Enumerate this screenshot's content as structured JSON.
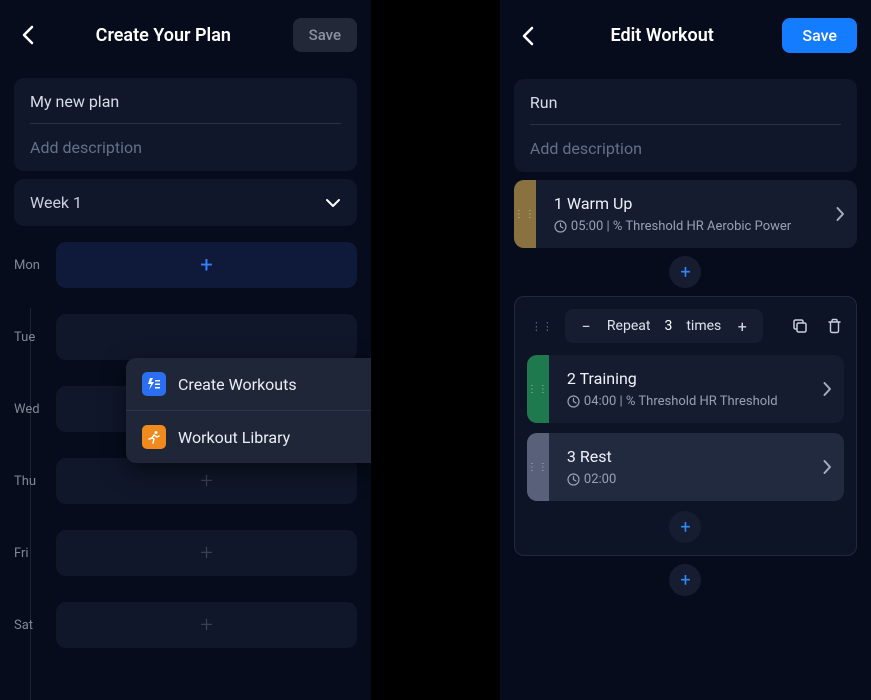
{
  "left": {
    "title": "Create Your Plan",
    "save": "Save",
    "planName": "My new plan",
    "descPlaceholder": "Add description",
    "weekLabel": "Week 1",
    "days": [
      "Mon",
      "Tue",
      "Wed",
      "Thu",
      "Fri",
      "Sat"
    ],
    "popup": {
      "create": "Create Workouts",
      "library": "Workout Library"
    }
  },
  "right": {
    "title": "Edit Workout",
    "save": "Save",
    "workoutName": "Run",
    "descPlaceholder": "Add description",
    "intervals": {
      "warmup": {
        "title": "1 Warm Up",
        "meta": "05:00 | % Threshold HR Aerobic Power"
      },
      "repeat": {
        "label": "Repeat",
        "count": "3",
        "suffix": "times"
      },
      "training": {
        "title": "2 Training",
        "meta": "04:00 | % Threshold HR Threshold"
      },
      "rest": {
        "title": "3 Rest",
        "meta": "02:00"
      }
    }
  }
}
